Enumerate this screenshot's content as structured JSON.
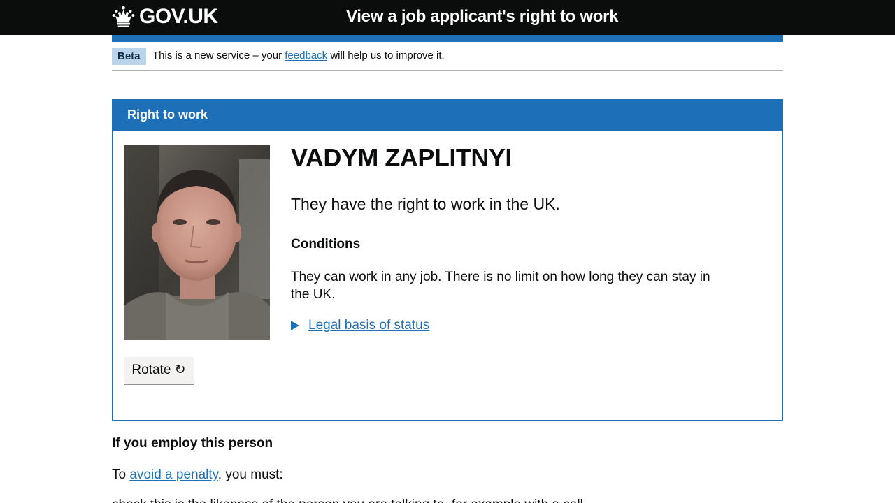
{
  "header": {
    "logo_text": "GOV.UK",
    "service_name": "View a job applicant's right to work"
  },
  "phase_banner": {
    "tag": "Beta",
    "text_before": "This is a new service – your",
    "link": "feedback",
    "text_after": "will help us to improve it."
  },
  "panel": {
    "heading": "Right to work",
    "name": "VADYM ZAPLITNYI",
    "status": "They have the right to work in the UK.",
    "conditions_heading": "Conditions",
    "conditions_text": "They can work in any job. There is no limit on how long they can stay in the UK.",
    "details_summary": "Legal basis of status",
    "rotate_button": "Rotate ↻"
  },
  "employ": {
    "heading": "If you employ this person",
    "text_before": "To",
    "link": "avoid a penalty",
    "text_after": ", you must:",
    "list_item_partial": "check this is the likeness of the person you are talking to, for example with a call"
  },
  "colors": {
    "header_bg": "#0b0c0c",
    "brand_blue": "#1d70b8",
    "tag_bg": "#bbd4ea",
    "button_bg": "#f3f2f1"
  }
}
